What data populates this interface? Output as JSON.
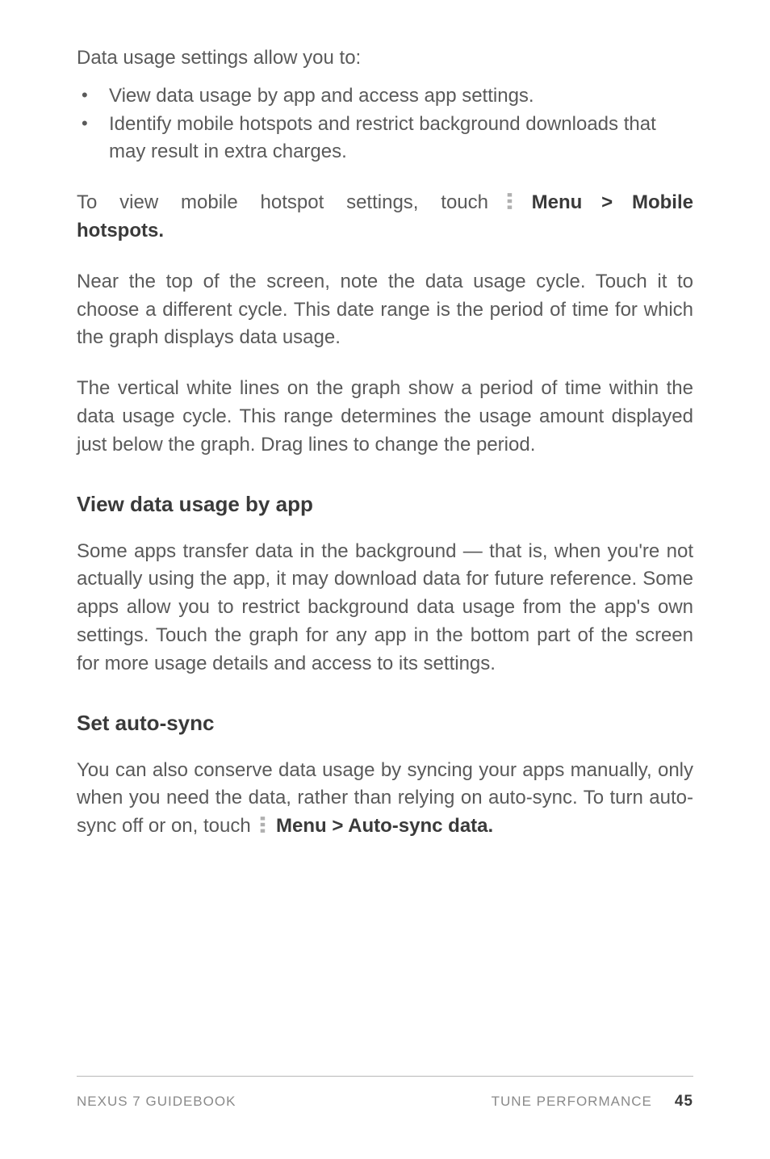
{
  "p_intro": "Data usage settings allow you to:",
  "bullets": {
    "b1": "View data usage by app and access app settings.",
    "b2": "Identify mobile hotspots and restrict background downloads that may result in extra charges."
  },
  "p_hotspot_prefix": "To view mobile hotspot settings, touch",
  "p_hotspot_bold": "Menu > Mobile hotspots.",
  "p_cycle": "Near the top of the screen, note the data usage cycle. Touch it to choose a different cycle. This date range is the period of time for which the graph displays data usage.",
  "p_graph": "The vertical white lines on the graph show a period of time within the data usage cycle. This range determines the usage amount displayed just below the graph. Drag lines to change the period.",
  "h_view": "View data usage by app",
  "p_view": "Some apps transfer data in the background — that is, when you're not actually using the app, it may download data for future reference. Some apps allow you to restrict background data usage from the app's own settings. Touch the graph for any app in the bottom part of the screen for more usage details and access to its settings.",
  "h_autosync": "Set auto-sync",
  "p_autosync_prefix": "You can also conserve data usage by syncing your apps manually, only when you need the data, rather than relying on auto-sync. To turn auto-sync off or on, touch",
  "p_autosync_bold": "Menu > Auto-sync data.",
  "footer": {
    "left": "NEXUS 7 GUIDEBOOK",
    "section": "TUNE PERFORMANCE",
    "page": "45"
  }
}
